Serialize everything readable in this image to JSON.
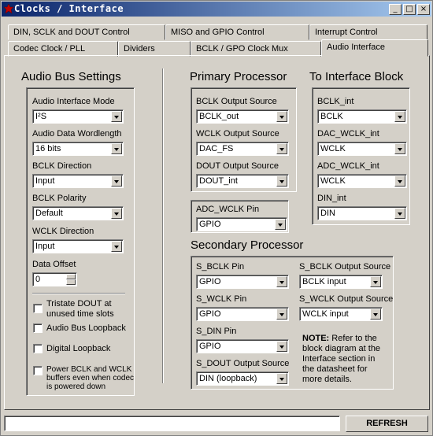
{
  "window": {
    "title": "Clocks / Interface"
  },
  "tabs": {
    "row1": [
      "DIN, SCLK and DOUT Control",
      "MISO and GPIO Control",
      "Interrupt Control"
    ],
    "row2": [
      "Codec Clock / PLL",
      "Dividers",
      "BCLK / GPO Clock Mux",
      "Audio Interface"
    ]
  },
  "audio_bus": {
    "heading": "Audio Bus Settings",
    "mode_label": "Audio Interface Mode",
    "mode_value": "I²S",
    "wordlength_label": "Audio Data Wordlength",
    "wordlength_value": "16 bits",
    "bclk_dir_label": "BCLK Direction",
    "bclk_dir_value": "Input",
    "bclk_pol_label": "BCLK Polarity",
    "bclk_pol_value": "Default",
    "wclk_dir_label": "WCLK Direction",
    "wclk_dir_value": "Input",
    "offset_label": "Data Offset",
    "offset_value": "0",
    "tristate_label_1": "Tristate DOUT at",
    "tristate_label_2": "unused time slots",
    "loopback_label": "Audio Bus Loopback",
    "digital_loopback_label": "Digital Loopback",
    "power_label_1": "Power BCLK and WCLK",
    "power_label_2": "buffers even when codec",
    "power_label_3": "is powered down"
  },
  "primary": {
    "heading": "Primary Processor",
    "bclk_out_label": "BCLK Output Source",
    "bclk_out_value": "BCLK_out",
    "wclk_out_label": "WCLK Output Source",
    "wclk_out_value": "DAC_FS",
    "dout_out_label": "DOUT Output Source",
    "dout_out_value": "DOUT_int",
    "adc_wclk_label": "ADC_WCLK Pin",
    "adc_wclk_value": "GPIO"
  },
  "interface_block": {
    "heading": "To Interface Block",
    "bclk_int_label": "BCLK_int",
    "bclk_int_value": "BCLK",
    "dac_wclk_label": "DAC_WCLK_int",
    "dac_wclk_value": "WCLK",
    "adc_wclk_label": "ADC_WCLK_int",
    "adc_wclk_value": "WCLK",
    "din_label": "DIN_int",
    "din_value": "DIN"
  },
  "secondary": {
    "heading": "Secondary Processor",
    "s_bclk_label": "S_BCLK Pin",
    "s_bclk_value": "GPIO",
    "s_wclk_label": "S_WCLK Pin",
    "s_wclk_value": "GPIO",
    "s_din_label": "S_DIN Pin",
    "s_din_value": "GPIO",
    "s_dout_label": "S_DOUT Output Source",
    "s_dout_value": "DIN (loopback)",
    "s_bclk_out_label": "S_BCLK Output Source",
    "s_bclk_out_value": "BCLK input",
    "s_wclk_out_label": "S_WCLK Output Source",
    "s_wclk_out_value": "WCLK input",
    "note_bold": "NOTE:",
    "note_line1": " Refer to the",
    "note_line2": "block diagram at the",
    "note_line3": "Interface section in",
    "note_line4": "the datasheet for",
    "note_line5": "more details."
  },
  "footer": {
    "refresh_label": "REFRESH",
    "status_value": ""
  }
}
